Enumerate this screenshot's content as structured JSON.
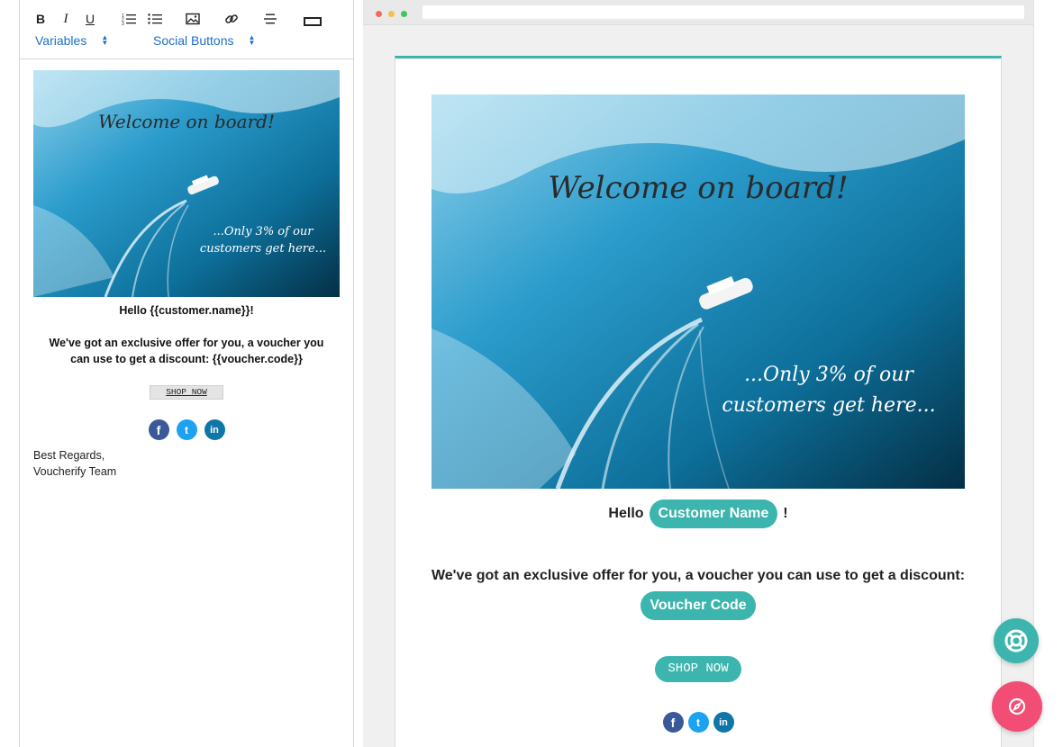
{
  "toolbar": {
    "bold_label": "B",
    "italic_label": "I",
    "underline_label": "U",
    "variables_label": "Variables",
    "social_buttons_label": "Social Buttons"
  },
  "hero": {
    "headline": "Welcome on board!",
    "tagline_line1": "...Only 3% of our",
    "tagline_line2": "customers get here..."
  },
  "editor": {
    "hello_line": "Hello {{customer.name}}!",
    "offer_line": "We've got an exclusive offer for you, a voucher you can use to get a discount: {{voucher.code}}",
    "shop_label": "SHOP NOW",
    "sign_line1": "Best Regards,",
    "sign_line2": "Voucherify Team"
  },
  "preview": {
    "hello_prefix": "Hello",
    "customer_pill": "Customer Name",
    "hello_suffix": "!",
    "offer_line": "We've got an exclusive offer for you, a voucher you can use to get a discount:",
    "voucher_pill": "Voucher Code",
    "shop_label": "SHOP NOW"
  },
  "social": {
    "facebook": "f",
    "twitter": "t",
    "linkedin": "in"
  },
  "colors": {
    "accent": "#3bb5ad",
    "link_blue": "#1f6fc4",
    "fab_pink": "#f24d74"
  },
  "icons": {
    "ordered_list": "ordered-list-icon",
    "bullet_list": "bullet-list-icon",
    "image": "image-icon",
    "link": "link-icon",
    "align": "align-icon",
    "button": "button-icon",
    "help": "lifebuoy-icon",
    "compass": "compass-icon"
  }
}
